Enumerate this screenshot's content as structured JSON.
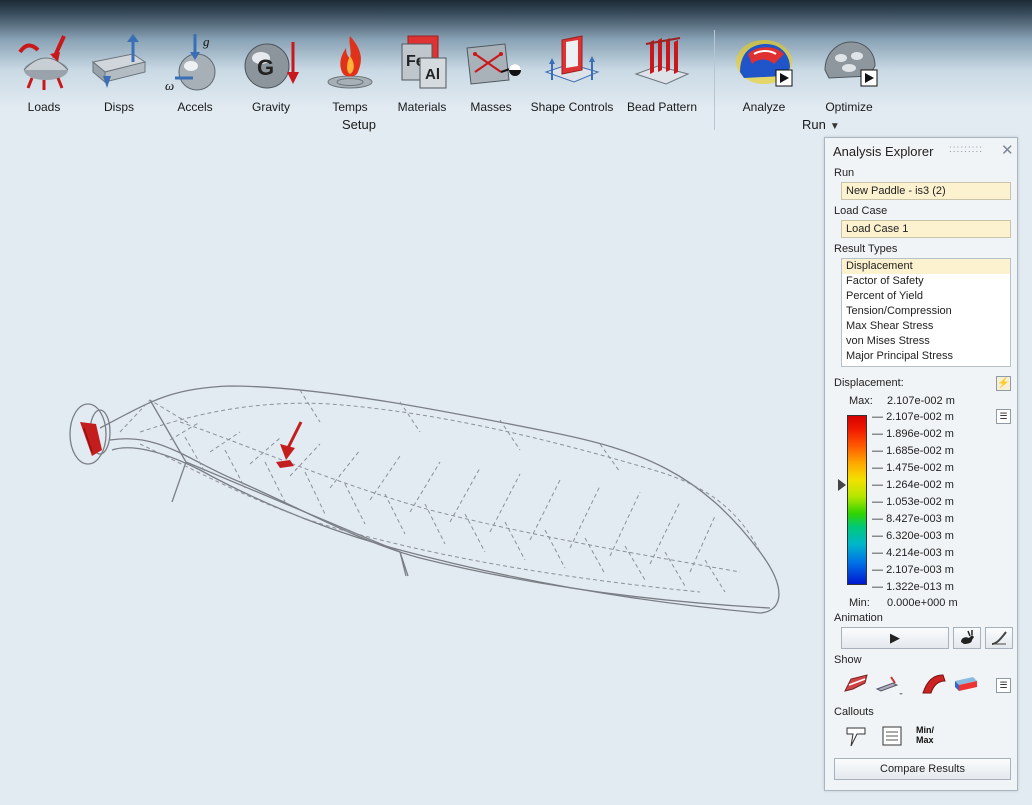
{
  "ribbon": {
    "tools": [
      {
        "label": "Loads",
        "icon": "loads-icon"
      },
      {
        "label": "Disps",
        "icon": "disps-icon"
      },
      {
        "label": "Accels",
        "icon": "accels-icon"
      },
      {
        "label": "Gravity",
        "icon": "gravity-icon"
      },
      {
        "label": "Temps",
        "icon": "temps-icon"
      },
      {
        "label": "Materials",
        "icon": "materials-icon"
      },
      {
        "label": "Masses",
        "icon": "masses-icon"
      },
      {
        "label": "Shape Controls",
        "icon": "shape-controls-icon"
      },
      {
        "label": "Bead Pattern",
        "icon": "bead-pattern-icon"
      },
      {
        "label": "Analyze",
        "icon": "analyze-icon"
      },
      {
        "label": "Optimize",
        "icon": "optimize-icon"
      }
    ],
    "setup_group_label": "Setup",
    "run_group_label": "Run",
    "accel_glyphs": {
      "g": "g",
      "omega": "ω"
    },
    "gravity_glyph": "G",
    "materials_glyphs": {
      "fe": "Fe",
      "al": "Al"
    }
  },
  "panel": {
    "title": "Analysis Explorer",
    "run_label": "Run",
    "run_value": "New Paddle - is3 (2)",
    "load_case_label": "Load Case",
    "load_case_value": "Load Case 1",
    "result_types_label": "Result Types",
    "result_types": [
      "Displacement",
      "Factor of Safety",
      "Percent of Yield",
      "Tension/Compression",
      "Max Shear Stress",
      "von Mises Stress",
      "Major Principal Stress"
    ],
    "selected_result_type": "Displacement",
    "legend_title": "Displacement:",
    "max_label": "Max:",
    "max_value": "2.107e-002 m",
    "min_label": "Min:",
    "min_value": "0.000e+000 m",
    "legend_values": [
      "2.107e-002 m",
      "1.896e-002 m",
      "1.685e-002 m",
      "1.475e-002 m",
      "1.264e-002 m",
      "1.053e-002 m",
      "8.427e-003 m",
      "6.320e-003 m",
      "4.214e-003 m",
      "2.107e-003 m",
      "1.322e-013 m"
    ],
    "animation_label": "Animation",
    "show_label": "Show",
    "callouts_label": "Callouts",
    "minmax_label_1": "Min/",
    "minmax_label_2": "Max",
    "compare_button": "Compare Results"
  },
  "colors": {
    "accent_red": "#d42020",
    "field_bg": "#fdf2cf",
    "model_line": "#7a7f85"
  }
}
